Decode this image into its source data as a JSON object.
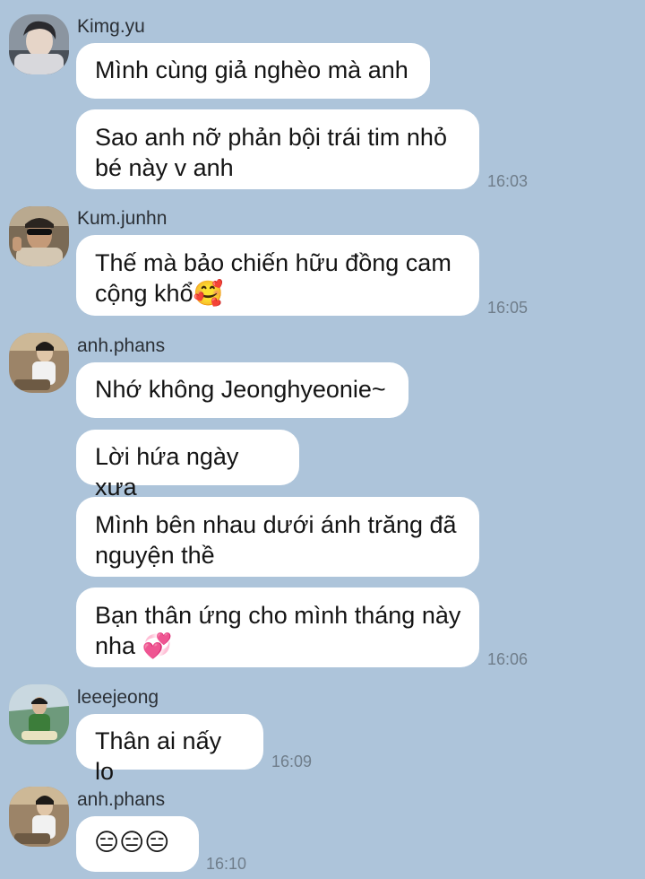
{
  "messages": [
    {
      "sender": "Kimg.yu",
      "bubbles": [
        "Mình cùng giả nghèo mà anh",
        "Sao anh nỡ phản bội trái tim nhỏ\nbé này v anh"
      ],
      "time": "16:03"
    },
    {
      "sender": "Kum.junhn",
      "bubbles": [
        "Thế mà bảo chiến hữu đồng cam\ncộng khổ🥰"
      ],
      "time": "16:05"
    },
    {
      "sender": "anh.phans",
      "bubbles": [
        "Nhớ không Jeonghyeonie~",
        "Lời hứa ngày xưa",
        "Mình bên nhau dưới ánh trăng đã\nnguyện thề",
        "Bạn thân ứng cho mình tháng này\nnha 💞"
      ],
      "time": "16:06"
    },
    {
      "sender": "leeejeong",
      "bubbles": [
        "Thân ai nấy lo"
      ],
      "time": "16:09"
    },
    {
      "sender": "anh.phans",
      "bubbles": [
        "😑😑😑"
      ],
      "time": "16:10"
    }
  ],
  "avatars": {
    "kimg_yu": "profile-photo-avatar",
    "kum_junhn": "profile-photo-avatar",
    "anh_phans": "profile-photo-avatar",
    "leeejeong": "profile-photo-avatar"
  },
  "colors": {
    "background": "#adc4da",
    "bubble": "#ffffff",
    "timestamp": "#6f7d8a"
  }
}
